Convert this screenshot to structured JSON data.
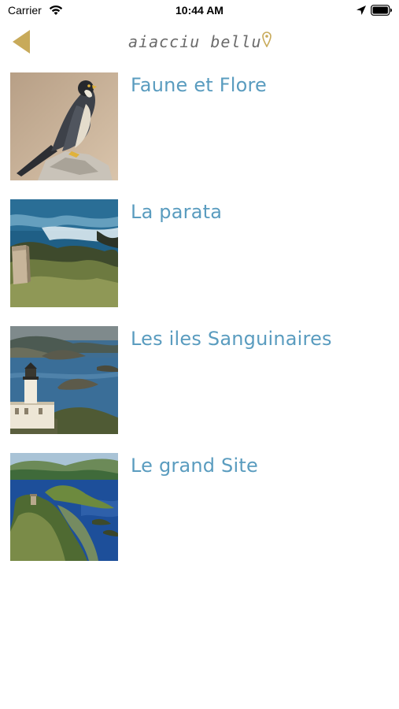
{
  "status_bar": {
    "carrier": "Carrier",
    "time": "10:44 AM",
    "icons": [
      "wifi-icon",
      "location-arrow-icon",
      "battery-icon"
    ]
  },
  "nav": {
    "back_icon": "back-arrow-icon",
    "logo_text": "aiacciu bellu",
    "accent_color": "#c8aa5a"
  },
  "items": [
    {
      "title": "Faune et Flore",
      "image": "peregrine-falcon-photo"
    },
    {
      "title": "La parata",
      "image": "coastline-tower-photo"
    },
    {
      "title": "Les iles Sanguinaires",
      "image": "lighthouse-islands-photo"
    },
    {
      "title": "Le grand Site",
      "image": "peninsula-aerial-photo"
    }
  ],
  "colors": {
    "title_color": "#5a9cbf",
    "background": "#ffffff"
  }
}
